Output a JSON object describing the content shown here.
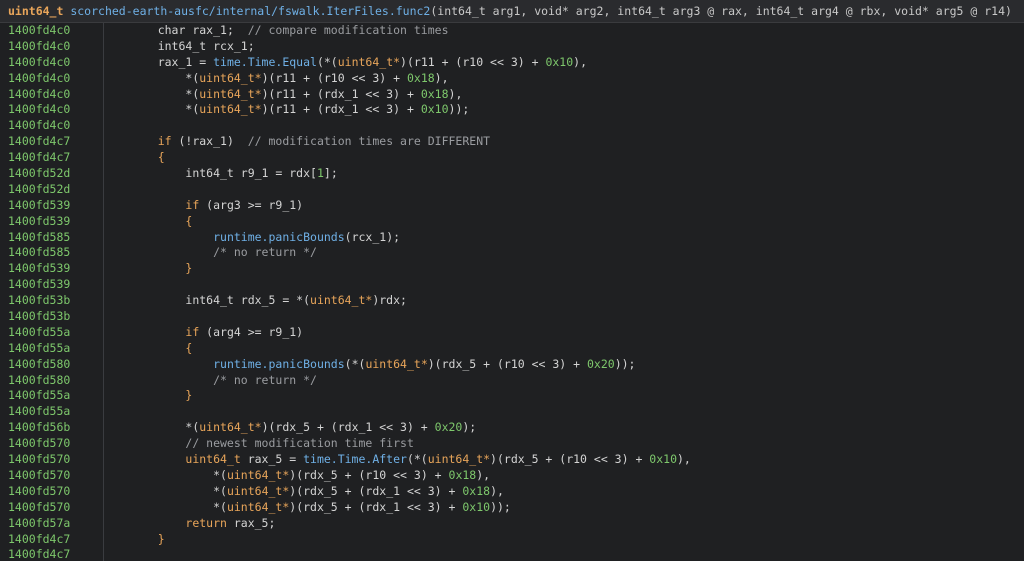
{
  "header": {
    "return_type": "uint64_t",
    "function_name": "scorched-earth-ausfc/internal/fswalk.IterFiles.func2",
    "params": "(int64_t arg1, void* arg2, int64_t arg3 @ rax, int64_t arg4 @ rbx, void* arg5 @ r14)"
  },
  "lines": [
    {
      "addr": "1400fd4c0",
      "tokens": [
        [
          "",
          "    "
        ],
        [
          "var",
          "char rax_1;"
        ],
        [
          "cm",
          "  // compare modification times"
        ]
      ]
    },
    {
      "addr": "1400fd4c0",
      "tokens": [
        [
          "",
          "    "
        ],
        [
          "var",
          "int64_t rcx_1;"
        ]
      ]
    },
    {
      "addr": "1400fd4c0",
      "tokens": [
        [
          "",
          "    "
        ],
        [
          "var",
          "rax_1 = "
        ],
        [
          "fn",
          "time.Time.Equal"
        ],
        [
          "var",
          "(*("
        ],
        [
          "ty",
          "uint64_t*"
        ],
        [
          "var",
          ")(r11 + (r10 << 3) + "
        ],
        [
          "num",
          "0x10"
        ],
        [
          "var",
          "),"
        ]
      ]
    },
    {
      "addr": "1400fd4c0",
      "tokens": [
        [
          "",
          "        "
        ],
        [
          "var",
          "*("
        ],
        [
          "ty",
          "uint64_t*"
        ],
        [
          "var",
          ")(r11 + (r10 << 3) + "
        ],
        [
          "num",
          "0x18"
        ],
        [
          "var",
          "),"
        ]
      ]
    },
    {
      "addr": "1400fd4c0",
      "tokens": [
        [
          "",
          "        "
        ],
        [
          "var",
          "*("
        ],
        [
          "ty",
          "uint64_t*"
        ],
        [
          "var",
          ")(r11 + (rdx_1 << 3) + "
        ],
        [
          "num",
          "0x18"
        ],
        [
          "var",
          "),"
        ]
      ]
    },
    {
      "addr": "1400fd4c0",
      "tokens": [
        [
          "",
          "        "
        ],
        [
          "var",
          "*("
        ],
        [
          "ty",
          "uint64_t*"
        ],
        [
          "var",
          ")(r11 + (rdx_1 << 3) + "
        ],
        [
          "num",
          "0x10"
        ],
        [
          "var",
          "));"
        ]
      ]
    },
    {
      "addr": "1400fd4c0",
      "tokens": []
    },
    {
      "addr": "1400fd4c7",
      "tokens": [
        [
          "",
          "    "
        ],
        [
          "kw",
          "if"
        ],
        [
          "var",
          " (!rax_1)"
        ],
        [
          "cm",
          "  // modification times are DIFFERENT"
        ]
      ]
    },
    {
      "addr": "1400fd4c7",
      "tokens": [
        [
          "",
          "    "
        ],
        [
          "kw",
          "{"
        ]
      ]
    },
    {
      "addr": "1400fd52d",
      "tokens": [
        [
          "",
          "        "
        ],
        [
          "var",
          "int64_t r9_1 = rdx["
        ],
        [
          "num",
          "1"
        ],
        [
          "var",
          "];"
        ]
      ]
    },
    {
      "addr": "1400fd52d",
      "tokens": []
    },
    {
      "addr": "1400fd539",
      "tokens": [
        [
          "",
          "        "
        ],
        [
          "kw",
          "if"
        ],
        [
          "var",
          " (arg3 >= r9_1)"
        ]
      ]
    },
    {
      "addr": "1400fd539",
      "tokens": [
        [
          "",
          "        "
        ],
        [
          "kw",
          "{"
        ]
      ]
    },
    {
      "addr": "1400fd585",
      "tokens": [
        [
          "",
          "            "
        ],
        [
          "fn",
          "runtime.panicBounds"
        ],
        [
          "var",
          "(rcx_1);"
        ]
      ]
    },
    {
      "addr": "1400fd585",
      "tokens": [
        [
          "",
          "            "
        ],
        [
          "cm",
          "/* no return */"
        ]
      ]
    },
    {
      "addr": "1400fd539",
      "tokens": [
        [
          "",
          "        "
        ],
        [
          "kw",
          "}"
        ]
      ]
    },
    {
      "addr": "1400fd539",
      "tokens": []
    },
    {
      "addr": "1400fd53b",
      "tokens": [
        [
          "",
          "        "
        ],
        [
          "var",
          "int64_t rdx_5 = *("
        ],
        [
          "ty",
          "uint64_t*"
        ],
        [
          "var",
          ")rdx;"
        ]
      ]
    },
    {
      "addr": "1400fd53b",
      "tokens": []
    },
    {
      "addr": "1400fd55a",
      "tokens": [
        [
          "",
          "        "
        ],
        [
          "kw",
          "if"
        ],
        [
          "var",
          " (arg4 >= r9_1)"
        ]
      ]
    },
    {
      "addr": "1400fd55a",
      "tokens": [
        [
          "",
          "        "
        ],
        [
          "kw",
          "{"
        ]
      ]
    },
    {
      "addr": "1400fd580",
      "tokens": [
        [
          "",
          "            "
        ],
        [
          "fn",
          "runtime.panicBounds"
        ],
        [
          "var",
          "(*("
        ],
        [
          "ty",
          "uint64_t*"
        ],
        [
          "var",
          ")(rdx_5 + (r10 << 3) + "
        ],
        [
          "num",
          "0x20"
        ],
        [
          "var",
          "));"
        ]
      ]
    },
    {
      "addr": "1400fd580",
      "tokens": [
        [
          "",
          "            "
        ],
        [
          "cm",
          "/* no return */"
        ]
      ]
    },
    {
      "addr": "1400fd55a",
      "tokens": [
        [
          "",
          "        "
        ],
        [
          "kw",
          "}"
        ]
      ]
    },
    {
      "addr": "1400fd55a",
      "tokens": []
    },
    {
      "addr": "1400fd56b",
      "tokens": [
        [
          "",
          "        "
        ],
        [
          "var",
          "*("
        ],
        [
          "ty",
          "uint64_t*"
        ],
        [
          "var",
          ")(rdx_5 + (rdx_1 << 3) + "
        ],
        [
          "num",
          "0x20"
        ],
        [
          "var",
          ");"
        ]
      ]
    },
    {
      "addr": "1400fd570",
      "tokens": [
        [
          "",
          "        "
        ],
        [
          "cm",
          "// newest modification time first"
        ]
      ]
    },
    {
      "addr": "1400fd570",
      "tokens": [
        [
          "",
          "        "
        ],
        [
          "ty",
          "uint64_t"
        ],
        [
          "var",
          " rax_5 = "
        ],
        [
          "fn",
          "time.Time.After"
        ],
        [
          "var",
          "(*("
        ],
        [
          "ty",
          "uint64_t*"
        ],
        [
          "var",
          ")(rdx_5 + (r10 << 3) + "
        ],
        [
          "num",
          "0x10"
        ],
        [
          "var",
          "),"
        ]
      ]
    },
    {
      "addr": "1400fd570",
      "tokens": [
        [
          "",
          "            "
        ],
        [
          "var",
          "*("
        ],
        [
          "ty",
          "uint64_t*"
        ],
        [
          "var",
          ")(rdx_5 + (r10 << 3) + "
        ],
        [
          "num",
          "0x18"
        ],
        [
          "var",
          "),"
        ]
      ]
    },
    {
      "addr": "1400fd570",
      "tokens": [
        [
          "",
          "            "
        ],
        [
          "var",
          "*("
        ],
        [
          "ty",
          "uint64_t*"
        ],
        [
          "var",
          ")(rdx_5 + (rdx_1 << 3) + "
        ],
        [
          "num",
          "0x18"
        ],
        [
          "var",
          "),"
        ]
      ]
    },
    {
      "addr": "1400fd570",
      "tokens": [
        [
          "",
          "            "
        ],
        [
          "var",
          "*("
        ],
        [
          "ty",
          "uint64_t*"
        ],
        [
          "var",
          ")(rdx_5 + (rdx_1 << 3) + "
        ],
        [
          "num",
          "0x10"
        ],
        [
          "var",
          "));"
        ]
      ]
    },
    {
      "addr": "1400fd57a",
      "tokens": [
        [
          "",
          "        "
        ],
        [
          "kw",
          "return"
        ],
        [
          "var",
          " rax_5;"
        ]
      ]
    },
    {
      "addr": "1400fd4c7",
      "tokens": [
        [
          "",
          "    "
        ],
        [
          "kw",
          "}"
        ]
      ]
    },
    {
      "addr": "1400fd4c7",
      "tokens": []
    }
  ]
}
